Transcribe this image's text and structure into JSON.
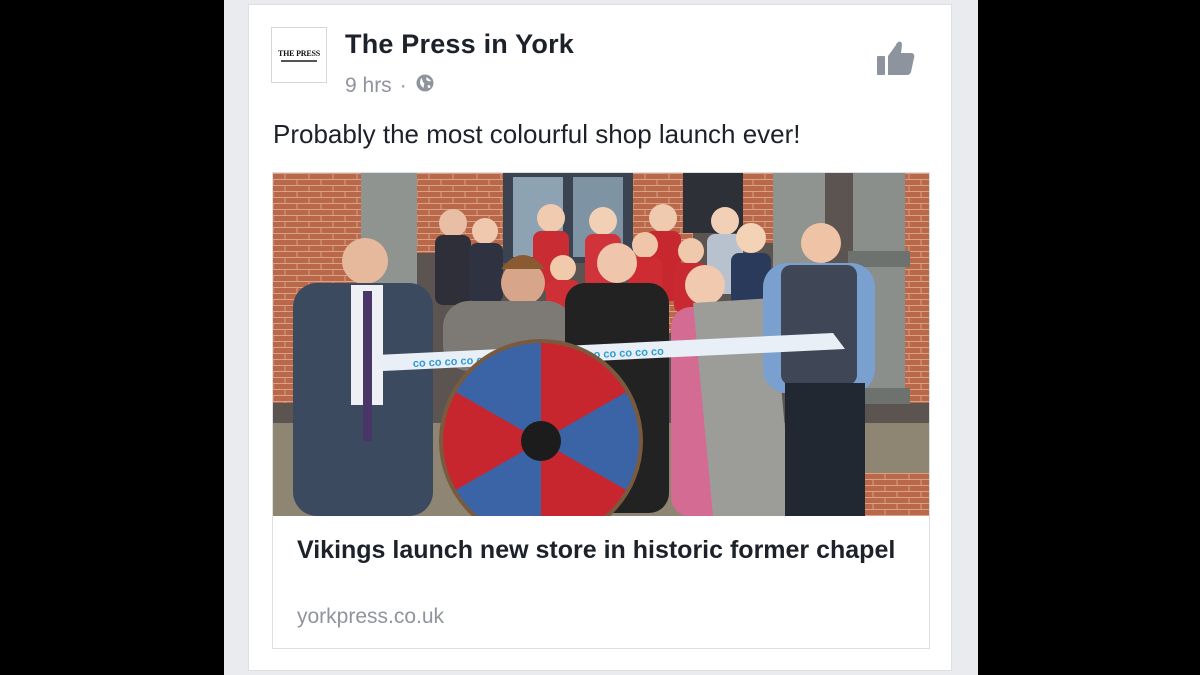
{
  "post": {
    "page_name": "The Press in York",
    "avatar_logo": "THE PRESS",
    "time": "9 hrs",
    "separator": "·",
    "privacy_icon": "globe-icon",
    "like_icon": "thumbs-up-icon",
    "text": "Probably the most colourful shop launch ever!"
  },
  "link": {
    "title": "Vikings launch new store in historic former chapel",
    "domain": "yorkpress.co.uk",
    "image_alt": "People cutting a ribbon at a shop opening with a Viking shield",
    "ribbon_text": "co op co op co op co op co op co op co op co op co op co op co op co op co op co op"
  },
  "colors": {
    "text_primary": "#1d2129",
    "text_secondary": "#90949c",
    "like_icon": "#8d949e",
    "card_border": "#dddfe2"
  }
}
